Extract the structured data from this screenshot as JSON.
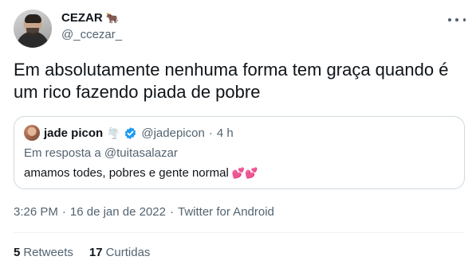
{
  "author": {
    "name": "CEZAR",
    "handle": "@_ccezar_",
    "name_emoji": "🐂"
  },
  "tweet": {
    "text": "Em absolutamente nenhuma forma tem graça quando é um rico fazendo piada de pobre"
  },
  "quoted": {
    "name": "jade picon",
    "name_emoji": "🌪️",
    "verified": true,
    "handle": "@jadepicon",
    "separator": "·",
    "time": "4 h",
    "reply_to": "Em resposta a @tuitasalazar",
    "text": "amamos todes, pobres e gente normal",
    "text_emoji": "💕💕"
  },
  "meta": {
    "time": "3:26 PM",
    "separator": "·",
    "date": "16 de jan de 2022",
    "separator2": "·",
    "source": "Twitter for Android"
  },
  "stats": {
    "retweets_count": "5",
    "retweets_label": "Retweets",
    "likes_count": "17",
    "likes_label": "Curtidas"
  },
  "colors": {
    "verified": "#1d9bf0",
    "secondary_text": "#536471",
    "border": "#cfd9de"
  }
}
